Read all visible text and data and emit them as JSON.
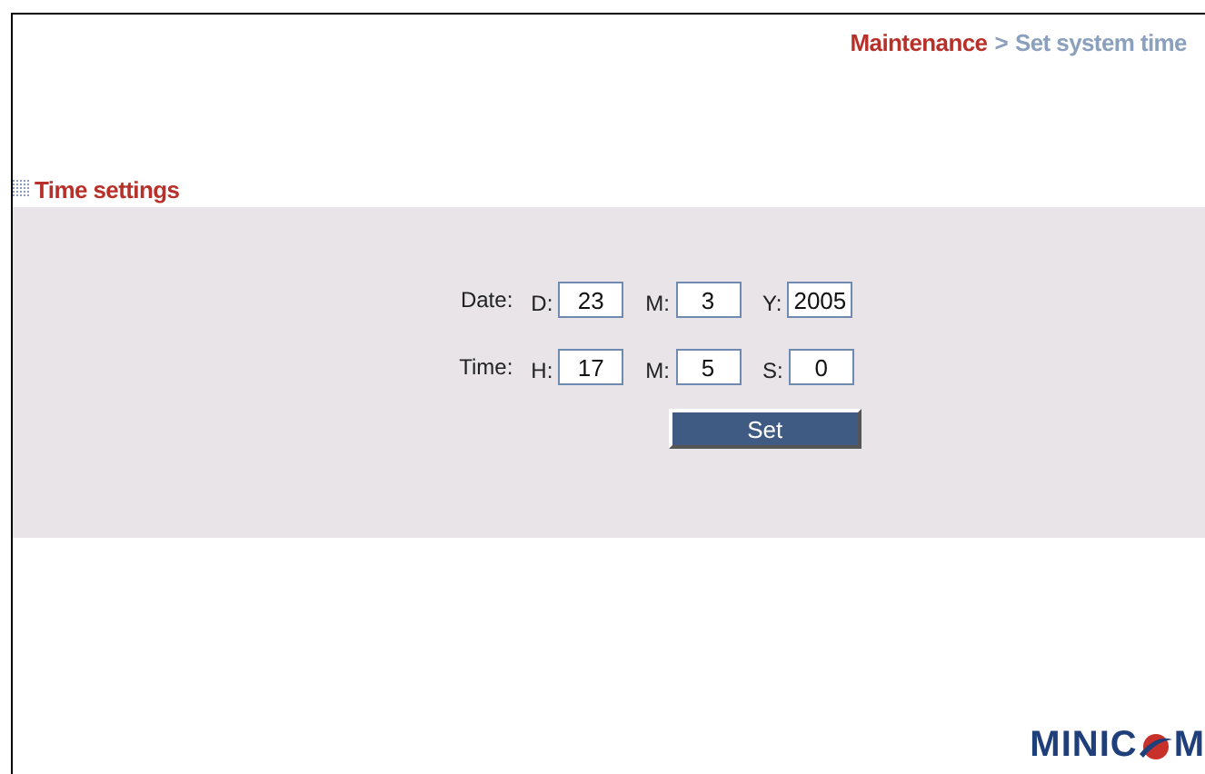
{
  "breadcrumb": {
    "section": "Maintenance",
    "separator": ">",
    "page": "Set system time"
  },
  "section_title": "Time settings",
  "rows": [
    {
      "label": "Date:",
      "fields": [
        {
          "label": "D:",
          "value": "23"
        },
        {
          "label": "M:",
          "value": "3"
        },
        {
          "label": "Y:",
          "value": "2005"
        }
      ]
    },
    {
      "label": "Time:",
      "fields": [
        {
          "label": "H:",
          "value": "17"
        },
        {
          "label": "M:",
          "value": "5"
        },
        {
          "label": "S:",
          "value": "0"
        }
      ]
    }
  ],
  "set_button": "Set",
  "logo": {
    "before": "MINIC",
    "after": "M"
  }
}
